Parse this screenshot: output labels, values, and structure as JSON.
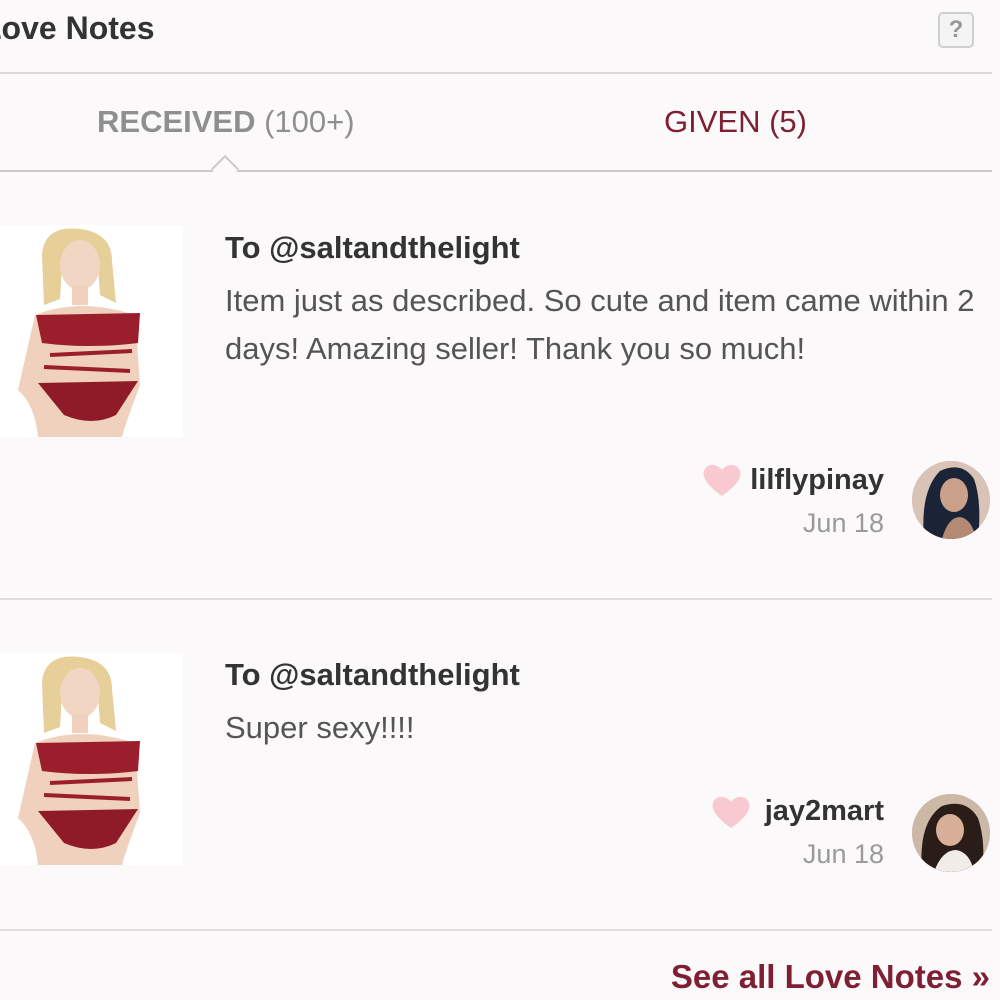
{
  "header": {
    "title": "Love Notes",
    "help_label": "?"
  },
  "tabs": {
    "received_label": "RECEIVED",
    "received_count": "(100+)",
    "given_label": "GIVEN (5)"
  },
  "notes": [
    {
      "recipient": "To @saltandthelight",
      "message": "Item just as described. So cute and item came within 2 days! Amazing seller! Thank you so much!",
      "author": "lilflypinay",
      "date": "Jun 18"
    },
    {
      "recipient": "To @saltandthelight",
      "message": "Super sexy!!!!",
      "author": "jay2mart",
      "date": "Jun 18"
    }
  ],
  "footer": {
    "see_all_label": "See all Love Notes »"
  },
  "colors": {
    "accent": "#7e1f33",
    "heart": "#f8c9d0",
    "background": "#fbf9fa"
  }
}
